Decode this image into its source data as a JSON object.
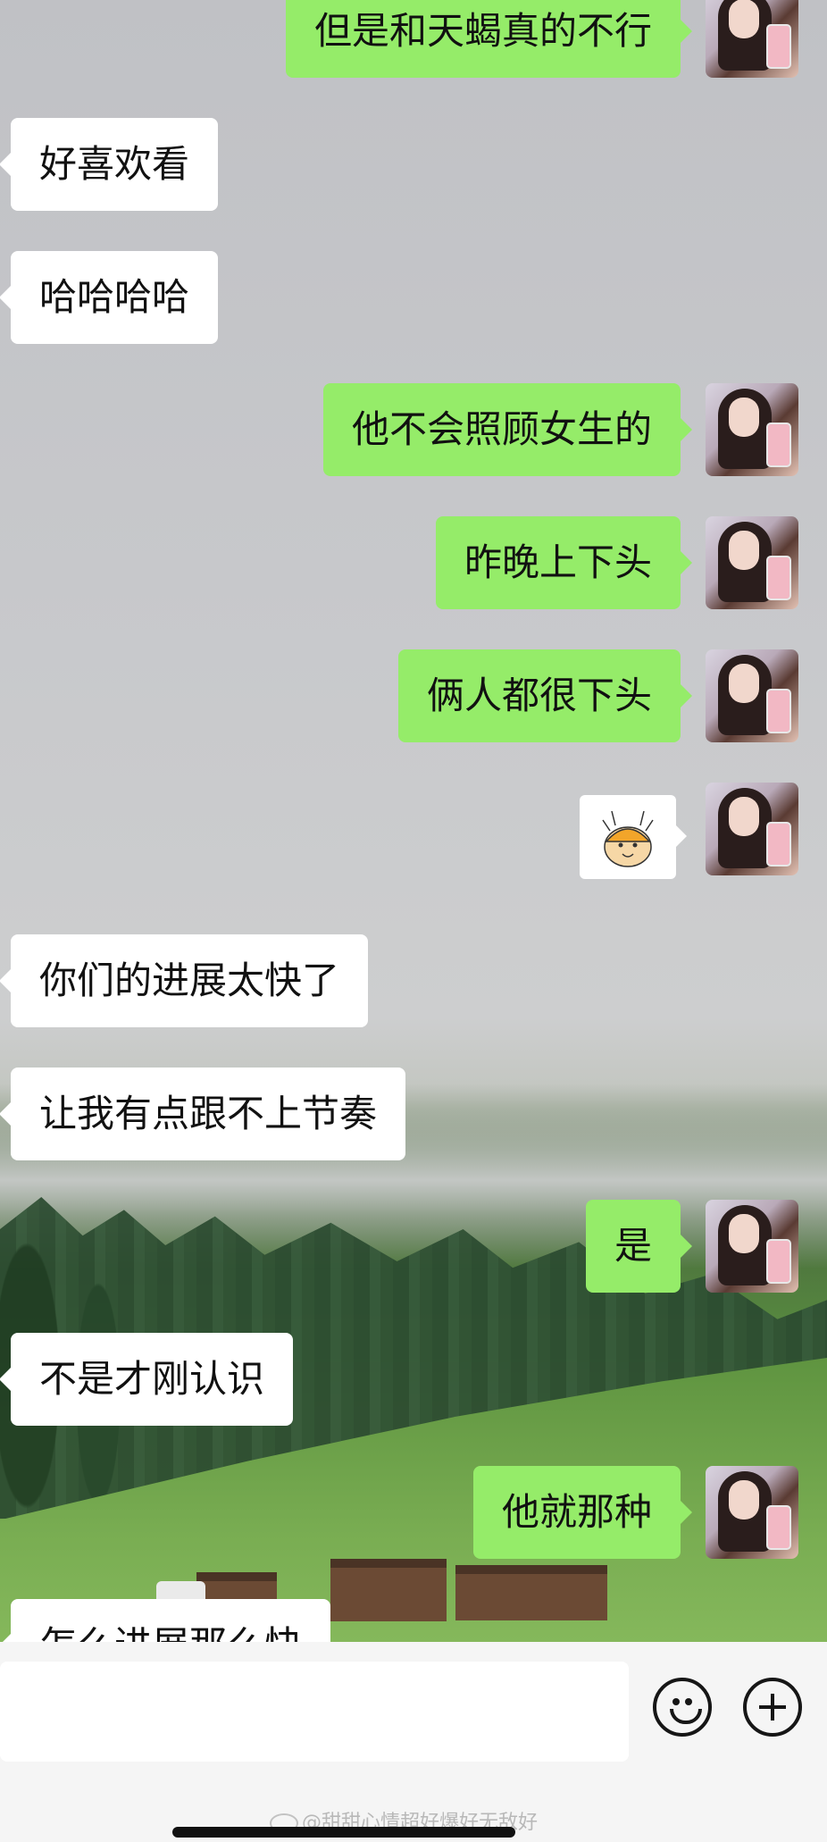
{
  "messages": [
    {
      "side": "right",
      "text": "但是和天蝎真的不行"
    },
    {
      "side": "left",
      "text": "好喜欢看"
    },
    {
      "side": "left",
      "text": "哈哈哈哈"
    },
    {
      "side": "right",
      "text": "他不会照顾女生的"
    },
    {
      "side": "right",
      "text": "昨晚上下头"
    },
    {
      "side": "right",
      "text": "俩人都很下头"
    },
    {
      "side": "right",
      "sticker": "shiba-dog-sticker"
    },
    {
      "side": "left",
      "text": "你们的进展太快了"
    },
    {
      "side": "left",
      "text": "让我有点跟不上节奏"
    },
    {
      "side": "right",
      "text": "是"
    },
    {
      "side": "left",
      "text": "不是才刚认识"
    },
    {
      "side": "right",
      "text": "他就那种"
    },
    {
      "side": "left",
      "text": "怎么进展那么快"
    }
  ],
  "input_bar": {
    "emoji_icon": "smiley-icon",
    "more_icon": "plus-circle-icon"
  },
  "watermark": "@甜甜心情超好爆好无敌好",
  "colors": {
    "sent_bubble": "#95ec69",
    "received_bubble": "#ffffff",
    "bar_bg": "#f5f5f5"
  }
}
